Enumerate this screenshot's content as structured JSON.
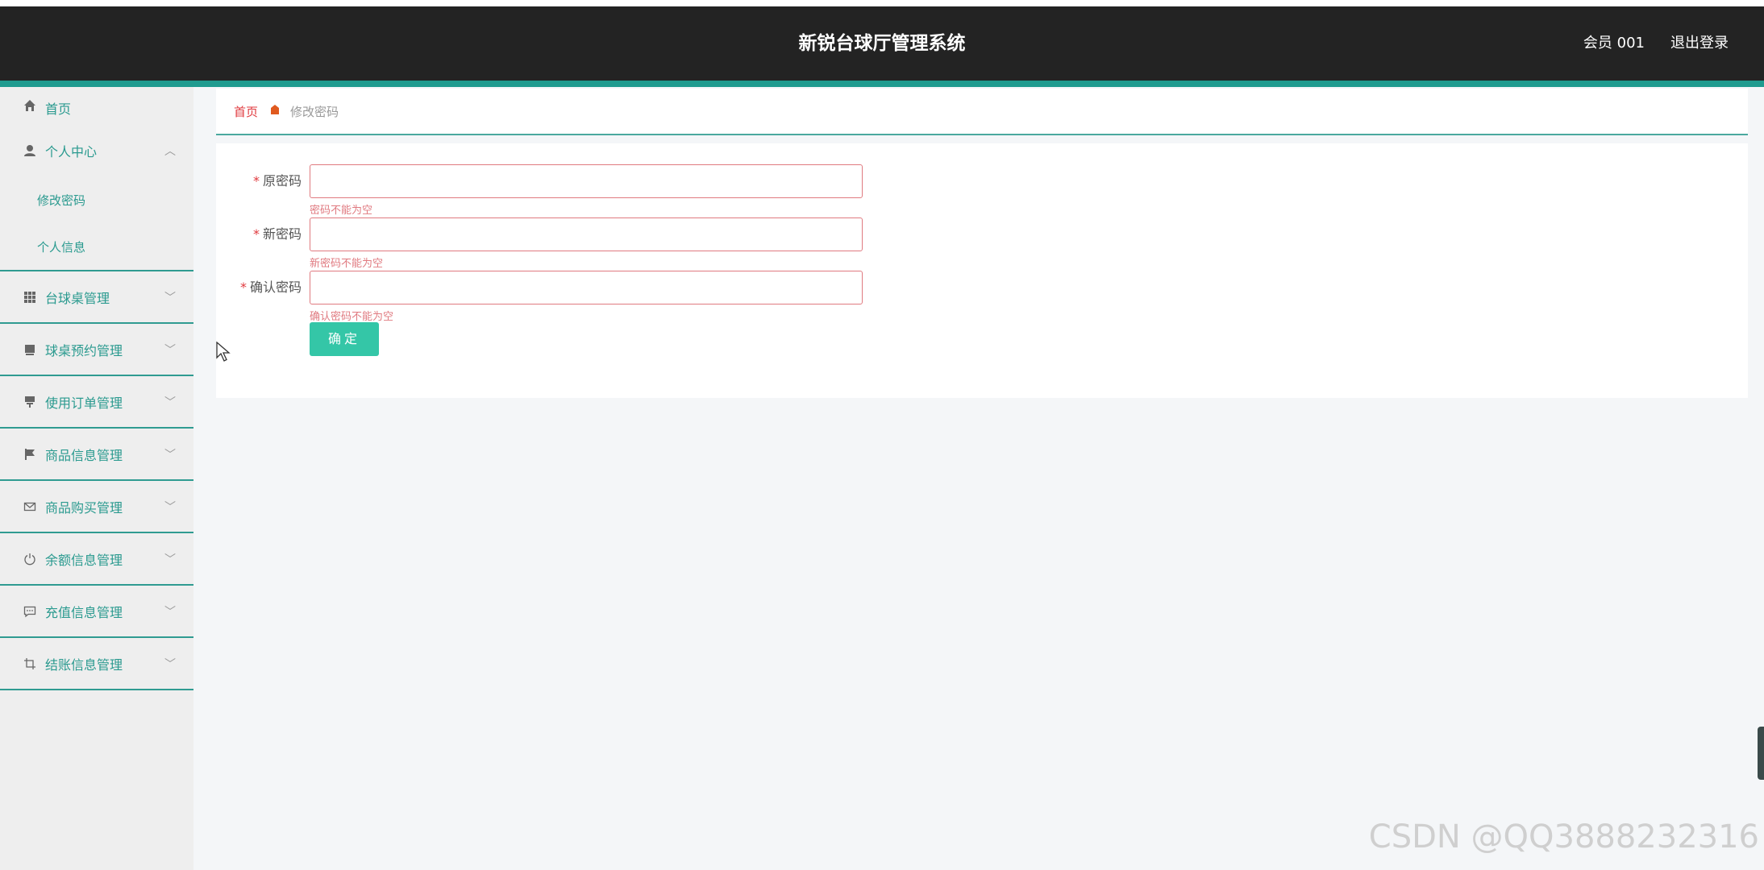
{
  "header": {
    "title": "新锐台球厅管理系统",
    "user": "会员 001",
    "logout": "退出登录"
  },
  "sidebar": {
    "home": "首页",
    "groups": [
      {
        "label": "个人中心",
        "icon": "user-icon",
        "expanded": true,
        "children": [
          "修改密码",
          "个人信息"
        ]
      },
      {
        "label": "台球桌管理",
        "icon": "grid-icon"
      },
      {
        "label": "球桌预约管理",
        "icon": "calendar-icon"
      },
      {
        "label": "使用订单管理",
        "icon": "order-icon"
      },
      {
        "label": "商品信息管理",
        "icon": "flag-icon"
      },
      {
        "label": "商品购买管理",
        "icon": "mail-icon"
      },
      {
        "label": "余额信息管理",
        "icon": "power-icon"
      },
      {
        "label": "充值信息管理",
        "icon": "chat-icon"
      },
      {
        "label": "结账信息管理",
        "icon": "crop-icon"
      }
    ]
  },
  "breadcrumb": {
    "home": "首页",
    "current": "修改密码"
  },
  "form": {
    "fields": [
      {
        "label": "原密码",
        "value": "",
        "error": "密码不能为空"
      },
      {
        "label": "新密码",
        "value": "",
        "error": "新密码不能为空"
      },
      {
        "label": "确认密码",
        "value": "",
        "error": "确认密码不能为空"
      }
    ],
    "submit": "确定"
  },
  "watermark": "CSDN @QQ3888232316",
  "colors": {
    "header_bg": "#232323",
    "accent": "#1f9b8f",
    "button": "#34c6a7",
    "error": "#e07a80"
  }
}
